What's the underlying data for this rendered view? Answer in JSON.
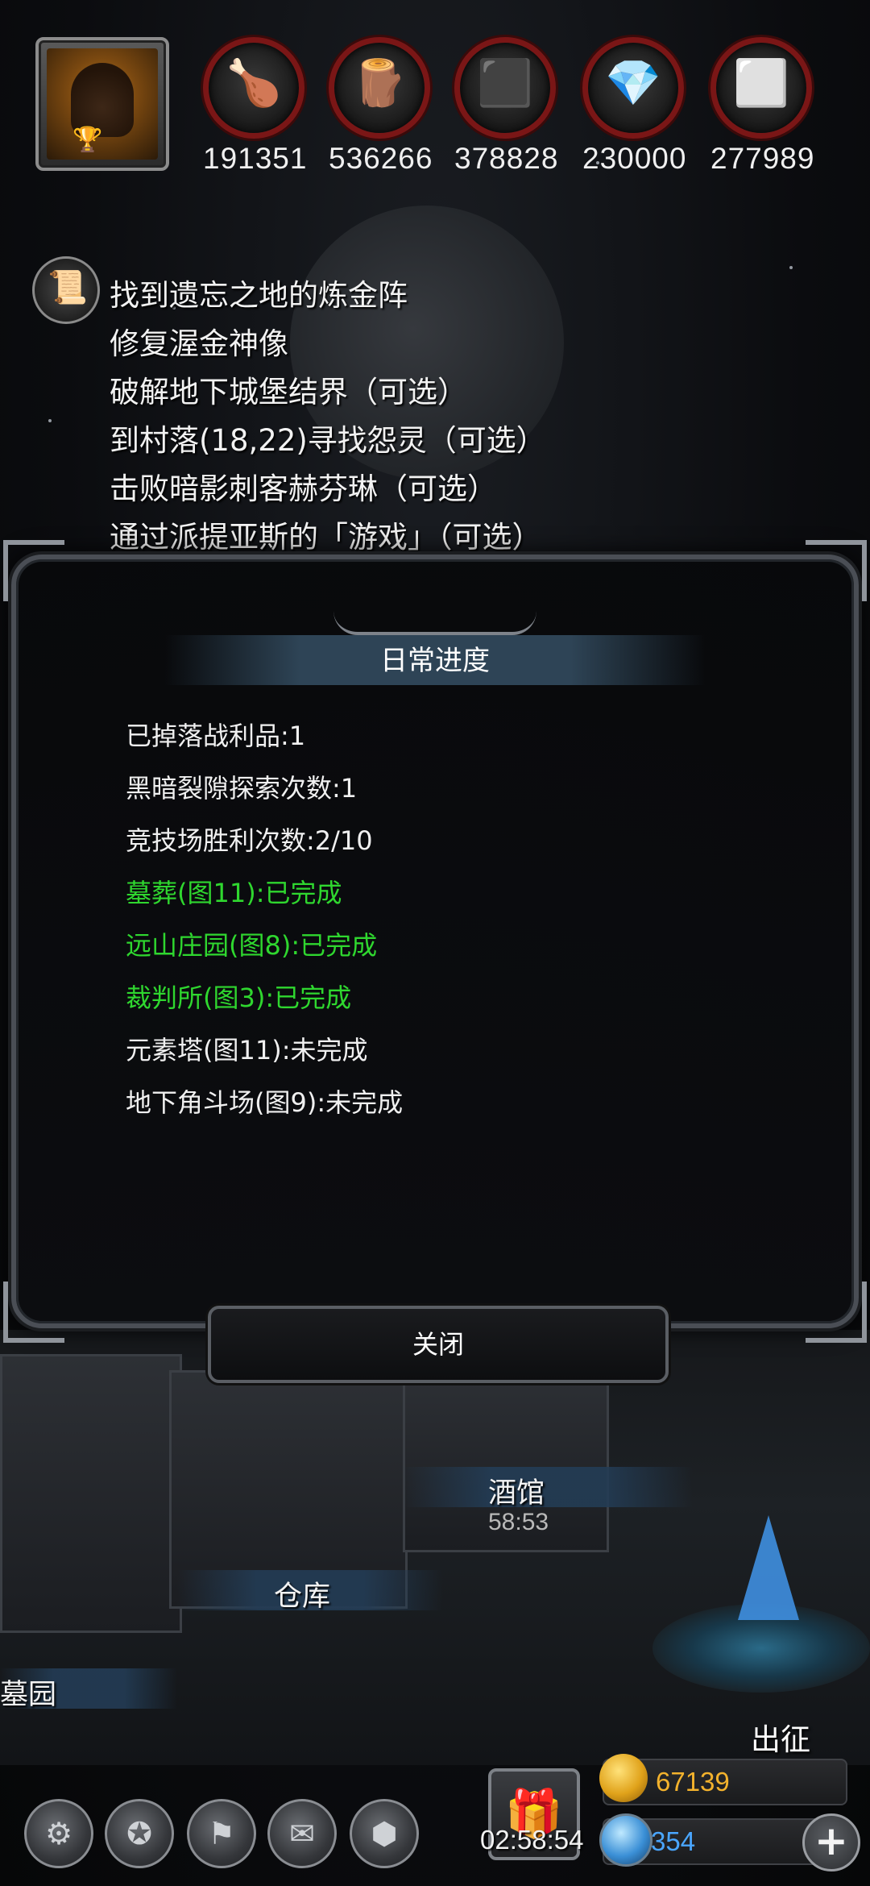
{
  "resources": [
    {
      "icon": "meat-icon",
      "glyph": "🍗",
      "value": "191351",
      "color": "#c8622a"
    },
    {
      "icon": "wood-icon",
      "glyph": "🪵",
      "value": "536266",
      "color": "#d98c3a"
    },
    {
      "icon": "stone-icon",
      "glyph": "⬛",
      "value": "378828",
      "color": "#9a9a9a"
    },
    {
      "icon": "crystal-icon",
      "glyph": "💎",
      "value": "230000",
      "color": "#3fa4ff"
    },
    {
      "icon": "iron-icon",
      "glyph": "⬜",
      "value": "277989",
      "color": "#aaaaaa"
    }
  ],
  "quests": [
    "找到遗忘之地的炼金阵",
    "修复渥金神像",
    "破解地下城堡结界（可选）",
    "到村落(18,22)寻找怨灵（可选）",
    "击败暗影刺客赫芬琳（可选）",
    "通过派提亚斯的「游戏」（可选）"
  ],
  "daily_panel": {
    "title": "日常进度",
    "items": [
      {
        "text": "已掉落战利品:1",
        "done": false
      },
      {
        "text": "黑暗裂隙探索次数:1",
        "done": false
      },
      {
        "text": "竞技场胜利次数:2/10",
        "done": false
      },
      {
        "text": "墓葬(图11):已完成",
        "done": true
      },
      {
        "text": "远山庄园(图8):已完成",
        "done": true
      },
      {
        "text": "裁判所(图3):已完成",
        "done": true
      },
      {
        "text": "元素塔(图11):未完成",
        "done": false
      },
      {
        "text": "地下角斗场(图9):未完成",
        "done": false
      }
    ],
    "close_label": "关闭"
  },
  "town": {
    "tavern": "酒馆",
    "tavern_timer": "58:53",
    "warehouse": "仓库",
    "cemetery": "墓园",
    "sortie": "出征"
  },
  "bottom": {
    "gift_timer": "02:58:54",
    "gold": "67139",
    "gems": "354",
    "buttons": [
      "settings-icon",
      "achievement-icon",
      "guild-icon",
      "mail-icon",
      "inventory-icon"
    ]
  },
  "colors": {
    "done": "#2fd72f",
    "gold": "#f3b22d",
    "gem": "#4aa6ff"
  }
}
